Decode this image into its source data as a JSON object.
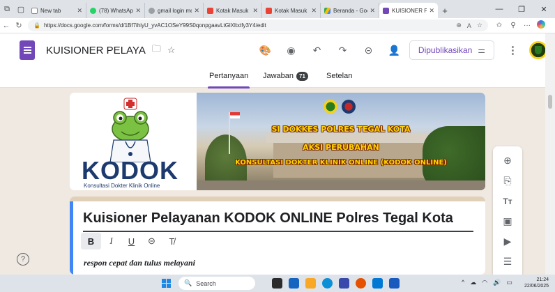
{
  "browser": {
    "tabs": [
      {
        "label": "New tab",
        "color": "#5f6368"
      },
      {
        "label": "(78) WhatsApp",
        "color": "#25d366"
      },
      {
        "label": "gmail login mo",
        "color": "#9aa0a6"
      },
      {
        "label": "Kotak Masuk (",
        "color": "#ea4335"
      },
      {
        "label": "Kotak Masuk (",
        "color": "#ea4335"
      },
      {
        "label": "Beranda - Goo",
        "color": "#fbbc04"
      },
      {
        "label": "KUISIONER PEL",
        "color": "#7248b9"
      }
    ],
    "url": "https://docs.google.com/forms/d/1Bf7ihiyU_yvAC1OSeY99S0qonpgaavLtGlXltxtfy3Y4/edit"
  },
  "header": {
    "form_title": "KUISIONER PELAYA",
    "publish_label": "Dipublikasikan",
    "brand_color": "#7248b9"
  },
  "tabs": {
    "questions": "Pertanyaan",
    "responses": "Jawaban",
    "responses_count": "71",
    "settings": "Setelan"
  },
  "banner": {
    "brand_word": "KODOK",
    "tagline": "Konsultasi Dokter Klinik Online",
    "line1": "SI DOKKES POLRES TEGAL KOTA",
    "line2": "AKSI PERUBAHAN",
    "line3": "KONSULTASI DOKTER KLINIK ONLINE (KODOK ONLINE)"
  },
  "form": {
    "title": "Kuisioner Pelayanan KODOK ONLINE Polres Tegal Kota",
    "description": "respon cepat dan tulus melayani",
    "format_buttons": [
      "B",
      "I",
      "U",
      "⊝",
      "T̸"
    ]
  },
  "side_toolbar": [
    "add-question",
    "import-questions",
    "add-title",
    "add-image",
    "add-video",
    "add-section"
  ],
  "taskbar": {
    "search_placeholder": "Search",
    "time": "21:24",
    "date": "22/06/2025"
  }
}
